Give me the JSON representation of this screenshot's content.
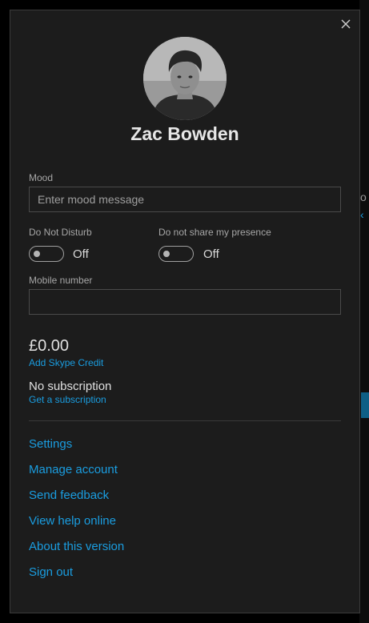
{
  "profile": {
    "name": "Zac Bowden"
  },
  "mood": {
    "label": "Mood",
    "placeholder": "Enter mood message"
  },
  "toggles": [
    {
      "label": "Do Not Disturb",
      "state": "Off"
    },
    {
      "label": "Do not share my presence",
      "state": "Off"
    }
  ],
  "mobile": {
    "label": "Mobile number",
    "value": ""
  },
  "credit": {
    "amount": "£0.00",
    "link": "Add Skype Credit"
  },
  "subscription": {
    "status": "No subscription",
    "link": "Get a subscription"
  },
  "menu": [
    "Settings",
    "Manage account",
    "Send feedback",
    "View help online",
    "About this version",
    "Sign out"
  ],
  "colors": {
    "panel_bg": "#1c1c1c",
    "accent_link": "#1a9de0",
    "text_primary": "#e6e6e6",
    "text_secondary": "#a6a6a6"
  },
  "icons": {
    "close": "close-icon",
    "avatar": "user-avatar"
  }
}
